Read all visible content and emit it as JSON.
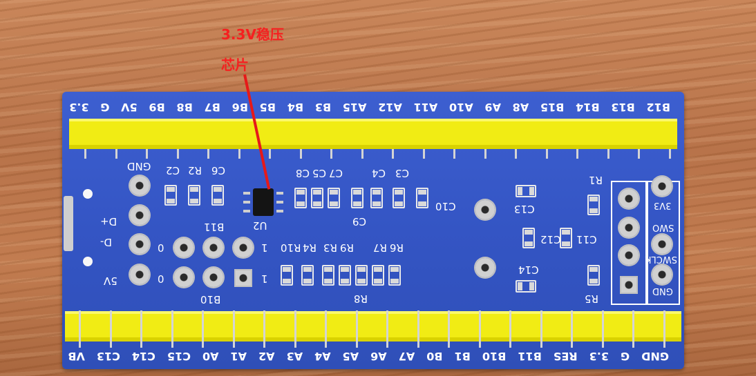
{
  "annotation": {
    "line1": "3.3V稳压",
    "line2": "芯片"
  },
  "top_pins": [
    "B12",
    "B13",
    "B14",
    "B15",
    "A8",
    "A9",
    "A10",
    "A11",
    "A12",
    "A15",
    "B3",
    "B4",
    "B5",
    "B6",
    "B7",
    "B8",
    "B9",
    "5V",
    "G",
    "3.3"
  ],
  "bottom_pins": [
    "GND",
    "G",
    "3.3",
    "RES",
    "B11",
    "B10",
    "B1",
    "B0",
    "A7",
    "A6",
    "A5",
    "A4",
    "A3",
    "A2",
    "A1",
    "A0",
    "C15",
    "C14",
    "C13",
    "VB"
  ],
  "silkscreen": {
    "gnd_left": "GND",
    "d_plus": "D+",
    "d_minus": "D-",
    "five_v": "5V",
    "b11": "B11",
    "b10": "B10",
    "zero_a": "0",
    "zero_b": "0",
    "one_a": "1",
    "one_b": "1",
    "u2": "U2",
    "swd_3v3": "3V3",
    "swd_swo": "SWO",
    "swd_swclk": "SWCLK",
    "swd_gnd": "GND",
    "r1": "R1",
    "r2": "R2",
    "r3": "R3",
    "r4": "R4",
    "r5": "R5",
    "r6": "R6",
    "r7": "R7",
    "r8": "R8",
    "r9": "R9",
    "r10": "R10",
    "c2": "C2",
    "c3": "C3",
    "c4": "C4",
    "c5": "C5",
    "c6": "C6",
    "c7": "C7",
    "c8": "C8",
    "c9": "C9",
    "c10": "C10",
    "c11": "C11",
    "c12": "C12",
    "c13": "C13",
    "c14": "C14"
  },
  "colors": {
    "annotation": "#f52020",
    "pcb": "#3455c4",
    "header": "#f1ec14"
  }
}
